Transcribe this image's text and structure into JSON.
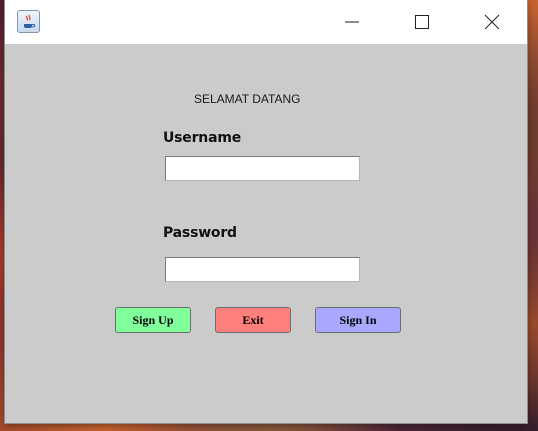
{
  "window": {
    "controls": {
      "minimize_icon": "minimize-icon",
      "maximize_icon": "maximize-icon",
      "close_icon": "close-icon"
    },
    "app_icon": "java-icon"
  },
  "form": {
    "welcome_text": "SELAMAT DATANG",
    "username_label": "Username",
    "username_value": "",
    "password_label": "Password",
    "password_value": ""
  },
  "buttons": {
    "signup_label": "Sign Up",
    "exit_label": "Exit",
    "signin_label": "Sign In"
  },
  "colors": {
    "content_bg": "#cbcbcb",
    "signup_bg": "#80ff9c",
    "exit_bg": "#ff7f7c",
    "signin_bg": "#a8a8ff"
  }
}
